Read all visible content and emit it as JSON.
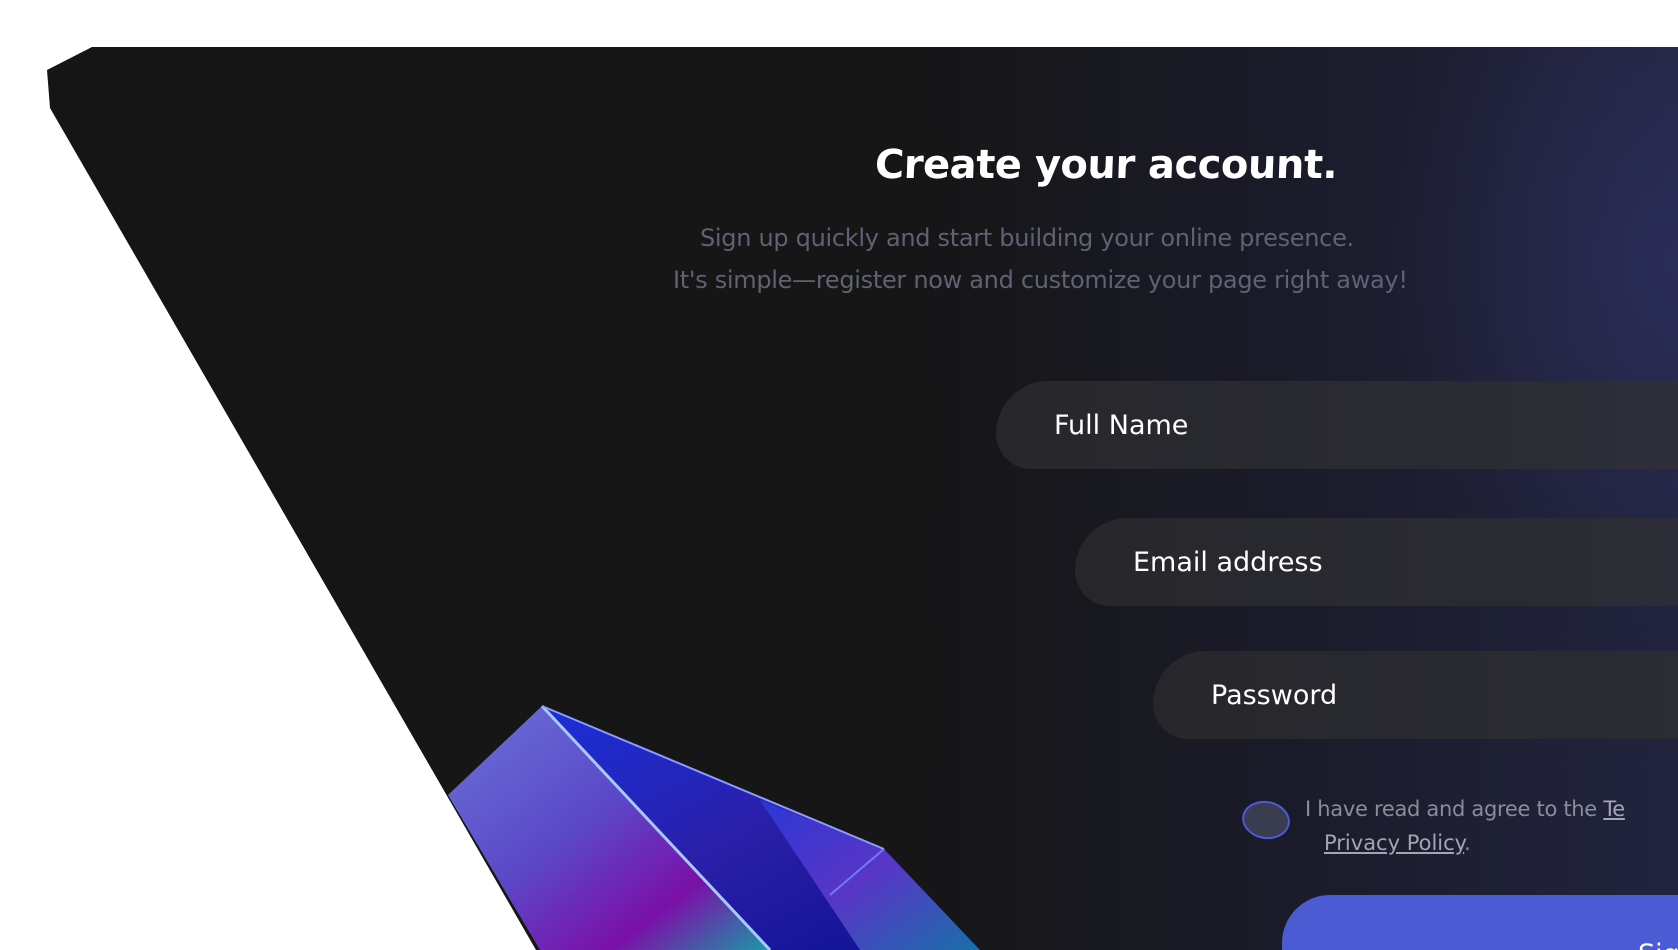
{
  "form": {
    "title": "Create your account.",
    "subtitle_line1": "Sign up quickly and start building your online presence.",
    "subtitle_line2": "It's simple—register now and customize your page right away!",
    "full_name_placeholder": "Full Name",
    "email_placeholder": "Email address",
    "password_placeholder": "Password",
    "consent_prefix": "I have read and agree to the ",
    "terms_link": "Te",
    "privacy_link": "Privacy Policy",
    "consent_suffix": ".",
    "submit_label": "Sig"
  },
  "colors": {
    "panel_background": "#151516",
    "accent": "#4b5bd4",
    "field_background": "#27272b",
    "heading": "#ffffff",
    "subtitle": "#5e6272"
  },
  "decor": {
    "prism_icon": "prism-3d-shape"
  }
}
